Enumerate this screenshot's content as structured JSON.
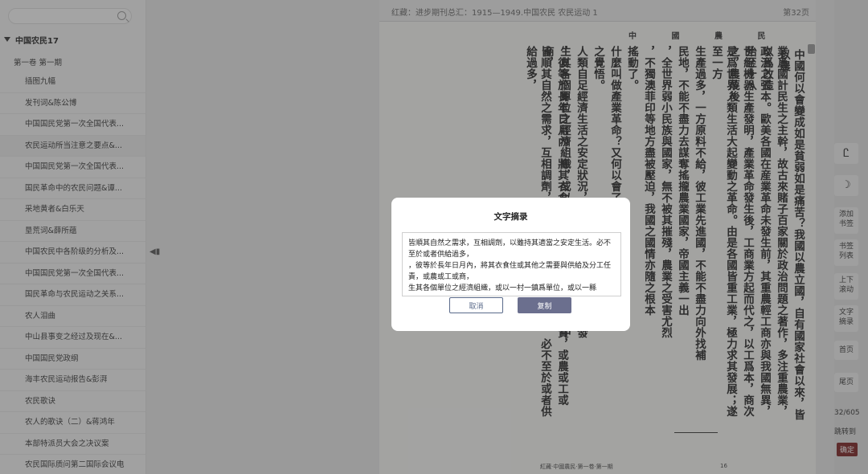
{
  "sidebar": {
    "search_placeholder": "",
    "root": "中国农民17",
    "volume": "第一卷 第一期",
    "items": [
      {
        "label": "插图九幅"
      },
      {
        "label": "发刊词&陈公博"
      },
      {
        "label": "中国国民党第一次全国代表..."
      },
      {
        "label": "农民运动所当注意之要点&..."
      },
      {
        "label": "中国国民党第一次全国代表..."
      },
      {
        "label": "国民革命中的农民问题&谭..."
      },
      {
        "label": "采地黄者&白乐天"
      },
      {
        "label": "垦荒词&薛所蕴"
      },
      {
        "label": "中国农民中各阶级的分析及..."
      },
      {
        "label": "中国国民党第一次全国代表..."
      },
      {
        "label": "国民革命与农民运动之关系..."
      },
      {
        "label": "农人泪曲"
      },
      {
        "label": "中山县事变之经过及现在&..."
      },
      {
        "label": "中国国民党政纲"
      },
      {
        "label": "海丰农民运动报告&彭湃"
      },
      {
        "label": "农民歌诀"
      },
      {
        "label": "农人的歌诀（二）&蒋鸿年"
      },
      {
        "label": "本部特派员大会之决议案"
      },
      {
        "label": "农民国际质问第二国际会议电"
      }
    ]
  },
  "reader": {
    "title": "红藏：进步期刊总汇：1915—1949.中国农民 农民运动 1",
    "page_label": "第32页",
    "header": "中  國  農  民",
    "columns": [
      "中國何以會變成如是貧弱如是痛苦？我國以農立國，自有國家社會以來，皆以農",
      "業爲國計民生之主幹，故古來賭子百家關於政治問題之著作，多注重農業，以爲改造",
      "政治之張本。歐美各國在産業革命未發生前，其重農輕工商亦與我國無異，殆至十八",
      "世紀機器生產發明，產業革命發生後，工商業方起而代之，以工爲本，商次之，農蔑後",
      "是爲世界人類生活大起變動之革命。由是各國皆重工業，極力求其發展；遂至一方",
      "生產過多，一方原料不給，彼工業先進國，不能不盡力向外找補",
      "民地，不能不盡力去謀奪搖攏農業國家，帝國主義一出",
      "，全世界弱小民族與國家，無不被其摧殘，農業之受害尤烈",
      "，不獨澳菲印等地方盡被壓迫，我國之國情亦隨之根本",
      "搖動了。",
      "什麼叫做產業革命？又何以會了解，方能發生深刻",
      "之覺悟。",
      "人類自足經濟生活之安定狀況，社會各個之環境不同，各發",
      "生其各個單位之經濟組織，或以家庭爲單位，或在其單位中",
      "，彼等於長年日月內，將其衣食任之需要與供給及分工任責，或農或工或商，",
      "皆順其自然之需求，互相調劑，以雖持其適當之安定生活，必不至於或者供給過多，"
    ],
    "footer": "紅藏·中國農民·第一卷·第一期",
    "footer_page": "16"
  },
  "modal": {
    "title": "文字摘录",
    "text": "皆順其自然之需求，互相調劑，以雖持其適當之安定生活。必不至於或者供給過多，\n，彼等於長年日月內，將其衣食住或其他之需要與供給及分工任責，或農或工或商，\n生其各個單位之經濟組織，或以一村一鎮爲單位，或以一縣",
    "cancel": "取消",
    "copy": "复制"
  },
  "tools": {
    "font": "Ꮭ",
    "night": "☽",
    "add_bookmark": "添加书签",
    "bookmark_list": "书签列表",
    "scroll": "上下滚动",
    "excerpt": "文字摘录",
    "first_page": "首页",
    "last_page": "尾页",
    "page_count": "32/605",
    "jump_to": "跳转到",
    "confirm": "确定"
  }
}
